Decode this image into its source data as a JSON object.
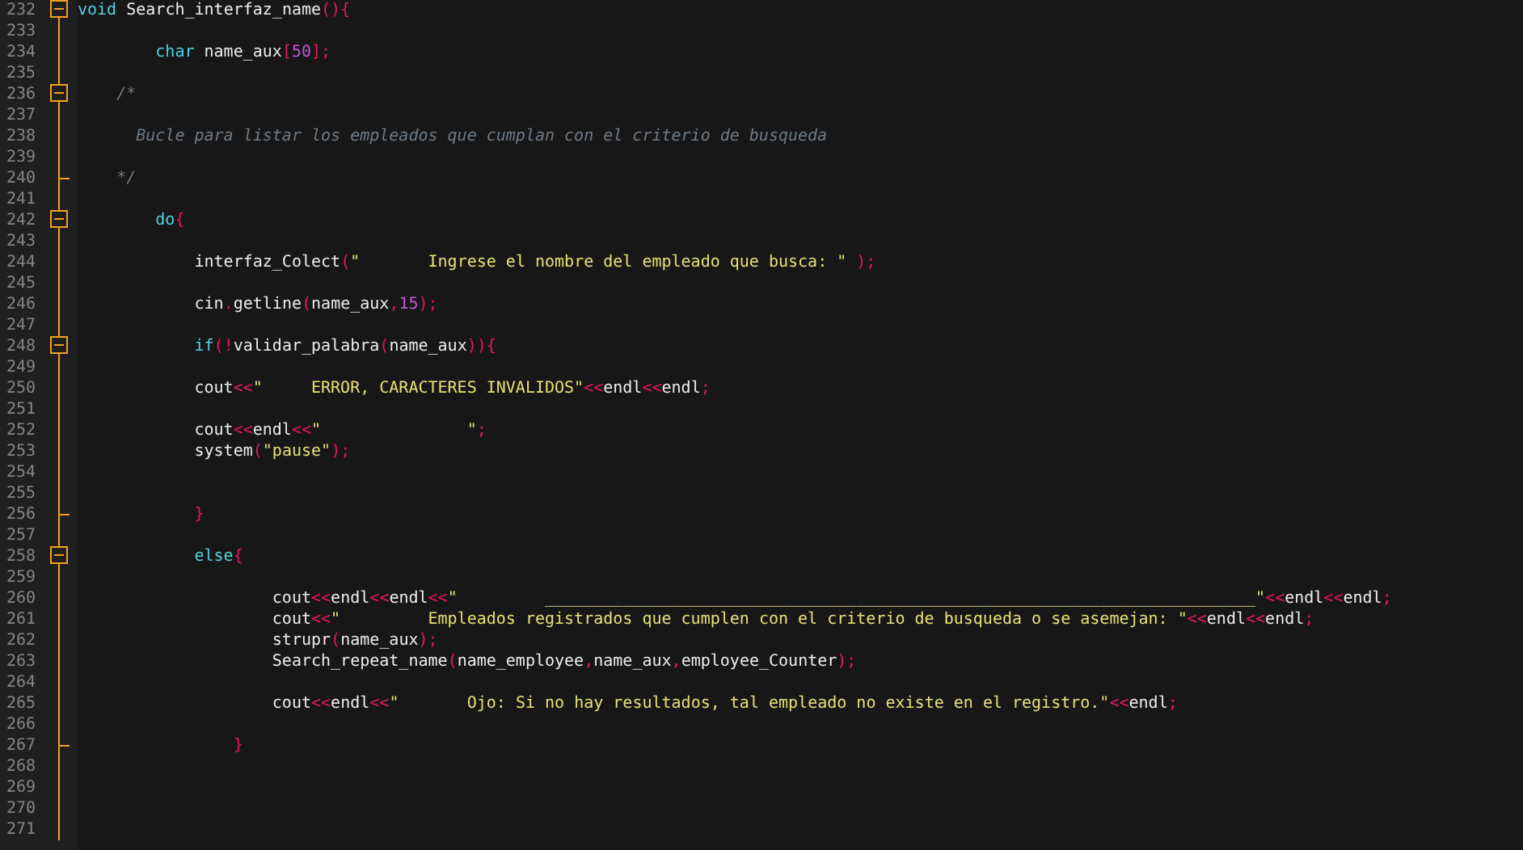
{
  "editor": {
    "lines": [
      {
        "number": "232",
        "kind": "fold_start",
        "tokens": [
          {
            "kind": "keyword",
            "text": "void"
          },
          {
            "kind": "ident",
            "text": " Search_interfaz_name"
          },
          {
            "kind": "punct",
            "text": "(){"
          }
        ]
      },
      {
        "number": "233",
        "kind": "plain"
      },
      {
        "number": "234",
        "kind": "plain",
        "tokens": [
          {
            "kind": "keyword",
            "text": "        char"
          },
          {
            "kind": "ident",
            "text": " name_aux"
          },
          {
            "kind": "punct",
            "text": "["
          },
          {
            "kind": "number",
            "text": "50"
          },
          {
            "kind": "punct",
            "text": "];"
          }
        ]
      },
      {
        "number": "235",
        "kind": "plain"
      },
      {
        "number": "236",
        "kind": "fold_start",
        "tokens": [
          {
            "kind": "comment",
            "text": "    /*"
          }
        ]
      },
      {
        "number": "237",
        "kind": "plain"
      },
      {
        "number": "238",
        "kind": "plain",
        "tokens": [
          {
            "kind": "comment",
            "text": "      Bucle para listar los empleados que cumplan con el criterio de busqueda"
          }
        ]
      },
      {
        "number": "239",
        "kind": "plain"
      },
      {
        "number": "240",
        "kind": "fold_end",
        "tokens": [
          {
            "kind": "comment",
            "text": "    */"
          }
        ]
      },
      {
        "number": "241",
        "kind": "plain"
      },
      {
        "number": "242",
        "kind": "fold_start",
        "tokens": [
          {
            "kind": "keyword",
            "text": "        do"
          },
          {
            "kind": "punct",
            "text": "{"
          }
        ]
      },
      {
        "number": "243",
        "kind": "plain"
      },
      {
        "number": "244",
        "kind": "plain",
        "tokens": [
          {
            "kind": "ident",
            "text": "            interfaz_Colect"
          },
          {
            "kind": "punct",
            "text": "("
          },
          {
            "kind": "string",
            "text": "\"       Ingrese el nombre del empleado que busca: \""
          },
          {
            "kind": "punct",
            "text": " );"
          }
        ]
      },
      {
        "number": "245",
        "kind": "plain"
      },
      {
        "number": "246",
        "kind": "plain",
        "tokens": [
          {
            "kind": "ident",
            "text": "            cin"
          },
          {
            "kind": "punct",
            "text": "."
          },
          {
            "kind": "ident",
            "text": "getline"
          },
          {
            "kind": "punct",
            "text": "("
          },
          {
            "kind": "ident",
            "text": "name_aux"
          },
          {
            "kind": "punct",
            "text": ","
          },
          {
            "kind": "number",
            "text": "15"
          },
          {
            "kind": "punct",
            "text": ");"
          }
        ]
      },
      {
        "number": "247",
        "kind": "plain"
      },
      {
        "number": "248",
        "kind": "fold_start",
        "tokens": [
          {
            "kind": "keyword",
            "text": "            if"
          },
          {
            "kind": "punct",
            "text": "(!"
          },
          {
            "kind": "ident",
            "text": "validar_palabra"
          },
          {
            "kind": "punct",
            "text": "("
          },
          {
            "kind": "ident",
            "text": "name_aux"
          },
          {
            "kind": "punct",
            "text": ")){"
          }
        ]
      },
      {
        "number": "249",
        "kind": "plain"
      },
      {
        "number": "250",
        "kind": "plain",
        "tokens": [
          {
            "kind": "ident",
            "text": "            cout"
          },
          {
            "kind": "punct",
            "text": "<<"
          },
          {
            "kind": "string",
            "text": "\"     ERROR, CARACTERES INVALIDOS\""
          },
          {
            "kind": "punct",
            "text": "<<"
          },
          {
            "kind": "ident",
            "text": "endl"
          },
          {
            "kind": "punct",
            "text": "<<"
          },
          {
            "kind": "ident",
            "text": "endl"
          },
          {
            "kind": "punct",
            "text": ";"
          }
        ]
      },
      {
        "number": "251",
        "kind": "plain"
      },
      {
        "number": "252",
        "kind": "plain",
        "tokens": [
          {
            "kind": "ident",
            "text": "            cout"
          },
          {
            "kind": "punct",
            "text": "<<"
          },
          {
            "kind": "ident",
            "text": "endl"
          },
          {
            "kind": "punct",
            "text": "<<"
          },
          {
            "kind": "string",
            "text": "\"               \""
          },
          {
            "kind": "punct",
            "text": ";"
          }
        ]
      },
      {
        "number": "253",
        "kind": "plain",
        "tokens": [
          {
            "kind": "ident",
            "text": "            system"
          },
          {
            "kind": "punct",
            "text": "("
          },
          {
            "kind": "string",
            "text": "\"pause\""
          },
          {
            "kind": "punct",
            "text": ");"
          }
        ]
      },
      {
        "number": "254",
        "kind": "plain"
      },
      {
        "number": "255",
        "kind": "plain"
      },
      {
        "number": "256",
        "kind": "fold_end",
        "tokens": [
          {
            "kind": "punct",
            "text": "            }"
          }
        ]
      },
      {
        "number": "257",
        "kind": "plain"
      },
      {
        "number": "258",
        "kind": "fold_start",
        "tokens": [
          {
            "kind": "keyword",
            "text": "            else"
          },
          {
            "kind": "punct",
            "text": "{"
          }
        ]
      },
      {
        "number": "259",
        "kind": "plain"
      },
      {
        "number": "260",
        "kind": "plain",
        "tokens": [
          {
            "kind": "ident",
            "text": "                    cout"
          },
          {
            "kind": "punct",
            "text": "<<"
          },
          {
            "kind": "ident",
            "text": "endl"
          },
          {
            "kind": "punct",
            "text": "<<"
          },
          {
            "kind": "ident",
            "text": "endl"
          },
          {
            "kind": "punct",
            "text": "<<"
          },
          {
            "kind": "string",
            "text": "\"         _________________________________________________________________________\""
          },
          {
            "kind": "punct",
            "text": "<<"
          },
          {
            "kind": "ident",
            "text": "endl"
          },
          {
            "kind": "punct",
            "text": "<<"
          },
          {
            "kind": "ident",
            "text": "endl"
          },
          {
            "kind": "punct",
            "text": ";"
          }
        ]
      },
      {
        "number": "261",
        "kind": "plain",
        "tokens": [
          {
            "kind": "ident",
            "text": "                    cout"
          },
          {
            "kind": "punct",
            "text": "<<"
          },
          {
            "kind": "string",
            "text": "\"         Empleados registrados que cumplen con el criterio de busqueda o se asemejan: \""
          },
          {
            "kind": "punct",
            "text": "<<"
          },
          {
            "kind": "ident",
            "text": "endl"
          },
          {
            "kind": "punct",
            "text": "<<"
          },
          {
            "kind": "ident",
            "text": "endl"
          },
          {
            "kind": "punct",
            "text": ";"
          }
        ]
      },
      {
        "number": "262",
        "kind": "plain",
        "tokens": [
          {
            "kind": "ident",
            "text": "                    strupr"
          },
          {
            "kind": "punct",
            "text": "("
          },
          {
            "kind": "ident",
            "text": "name_aux"
          },
          {
            "kind": "punct",
            "text": ");"
          }
        ]
      },
      {
        "number": "263",
        "kind": "plain",
        "tokens": [
          {
            "kind": "ident",
            "text": "                    Search_repeat_name"
          },
          {
            "kind": "punct",
            "text": "("
          },
          {
            "kind": "ident",
            "text": "name_employee"
          },
          {
            "kind": "punct",
            "text": ","
          },
          {
            "kind": "ident",
            "text": "name_aux"
          },
          {
            "kind": "punct",
            "text": ","
          },
          {
            "kind": "ident",
            "text": "employee_Counter"
          },
          {
            "kind": "punct",
            "text": ");"
          }
        ]
      },
      {
        "number": "264",
        "kind": "plain"
      },
      {
        "number": "265",
        "kind": "plain",
        "tokens": [
          {
            "kind": "ident",
            "text": "                    cout"
          },
          {
            "kind": "punct",
            "text": "<<"
          },
          {
            "kind": "ident",
            "text": "endl"
          },
          {
            "kind": "punct",
            "text": "<<"
          },
          {
            "kind": "string",
            "text": "\"       Ojo: Si no hay resultados, tal empleado no existe en el registro.\""
          },
          {
            "kind": "punct",
            "text": "<<"
          },
          {
            "kind": "ident",
            "text": "endl"
          },
          {
            "kind": "punct",
            "text": ";"
          }
        ]
      },
      {
        "number": "266",
        "kind": "plain"
      },
      {
        "number": "267",
        "kind": "fold_end",
        "tokens": [
          {
            "kind": "punct",
            "text": "                }"
          }
        ]
      },
      {
        "number": "268",
        "kind": "plain"
      },
      {
        "number": "269",
        "kind": "plain"
      },
      {
        "number": "270",
        "kind": "plain"
      },
      {
        "number": "271",
        "kind": "plain"
      }
    ]
  }
}
